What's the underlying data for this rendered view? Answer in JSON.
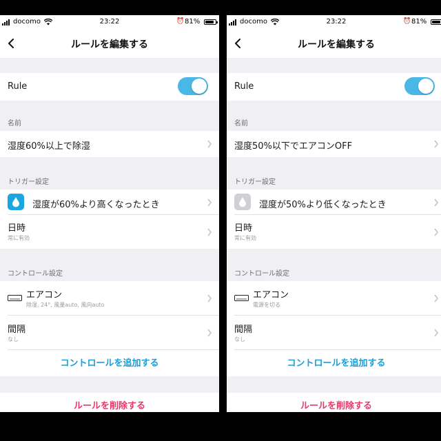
{
  "status_bar": {
    "carrier": "docomo",
    "time": "23:22",
    "battery": "81%"
  },
  "colors": {
    "accent": "#4ab8e6",
    "link": "#1a9ed6",
    "delete": "#e8386a",
    "humidity_active": "#1ba6e0",
    "humidity_inactive": "#cfcfd4"
  },
  "screens": [
    {
      "nav_title": "ルールを編集する",
      "rule_label": "Rule",
      "rule_enabled": true,
      "name_section": "名前",
      "name_value": "湿度60%以上で除湿",
      "trigger_section": "トリガー設定",
      "trigger_humidity": "湿度が60%より高くなったとき",
      "trigger_humidity_icon": "water-drop-icon",
      "trigger_time_title": "日時",
      "trigger_time_sub": "常に有効",
      "control_section": "コントロール設定",
      "control_ac_title": "エアコン",
      "control_ac_sub": "除湿, 24°, 風量auto, 風向auto",
      "control_ac_icon": "air-conditioner-icon",
      "control_interval_title": "間隔",
      "control_interval_sub": "なし",
      "add_control": "コントロールを追加する",
      "delete_rule": "ルールを削除する"
    },
    {
      "nav_title": "ルールを編集する",
      "rule_label": "Rule",
      "rule_enabled": true,
      "name_section": "名前",
      "name_value": "湿度50%以下でエアコンOFF",
      "trigger_section": "トリガー設定",
      "trigger_humidity": "湿度が50%より低くなったとき",
      "trigger_humidity_icon": "water-drop-icon",
      "trigger_time_title": "日時",
      "trigger_time_sub": "常に有効",
      "control_section": "コントロール設定",
      "control_ac_title": "エアコン",
      "control_ac_sub": "電源を切る",
      "control_ac_icon": "air-conditioner-icon",
      "control_interval_title": "間隔",
      "control_interval_sub": "なし",
      "add_control": "コントロールを追加する",
      "delete_rule": "ルールを削除する"
    }
  ]
}
